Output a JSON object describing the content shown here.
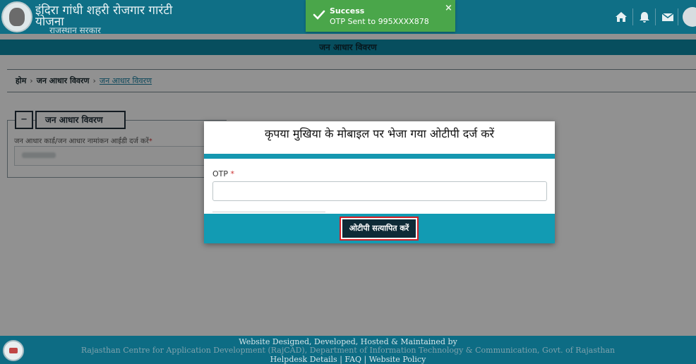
{
  "header": {
    "title_line1": "इंदिरा गांधी शहरी रोजगार गारंटी",
    "title_line2": "योजना",
    "subtitle": "राजस्थान सरकार",
    "icons": [
      "home-icon",
      "bell-icon",
      "mail-icon",
      "avatar"
    ]
  },
  "toast": {
    "title": "Success",
    "message": "OTP Sent to 995XXXX878",
    "close": "×"
  },
  "page_title": "जन आधार विवरण",
  "breadcrumb": {
    "home": "होम",
    "level1": "जन आधार विवरण",
    "current": "जन आधार विवरण"
  },
  "section": {
    "toggle": "–",
    "legend": "जन आधार विवरण",
    "field_label": "जन आधार कार्ड/जन आधार नामांकन आईडी दर्ज करें",
    "required_mark": "*"
  },
  "modal": {
    "title": "कृपया मुखिया के मोबाइल पर भेजा गया ओटीपी दर्ज करें",
    "otp_label": "OTP",
    "required_mark": "*",
    "otp_value": "",
    "verify_button": "ओटीपी सत्यापित करें"
  },
  "footer": {
    "line1": "Website Designed, Developed, Hosted & Maintained by",
    "line2": "Rajasthan Centre for Application Development (RajCAD), Department of Information Technology & Communication, Govt. of Rajasthan",
    "helpdesk": "Helpdesk Details",
    "faq": "FAQ",
    "policy": "Website Policy",
    "separator": "|"
  },
  "colors": {
    "header": "#0f6f86",
    "accent": "#129bb3",
    "toast": "#4aa64a",
    "button": "#0e2a36",
    "button_border": "#d31f26"
  }
}
